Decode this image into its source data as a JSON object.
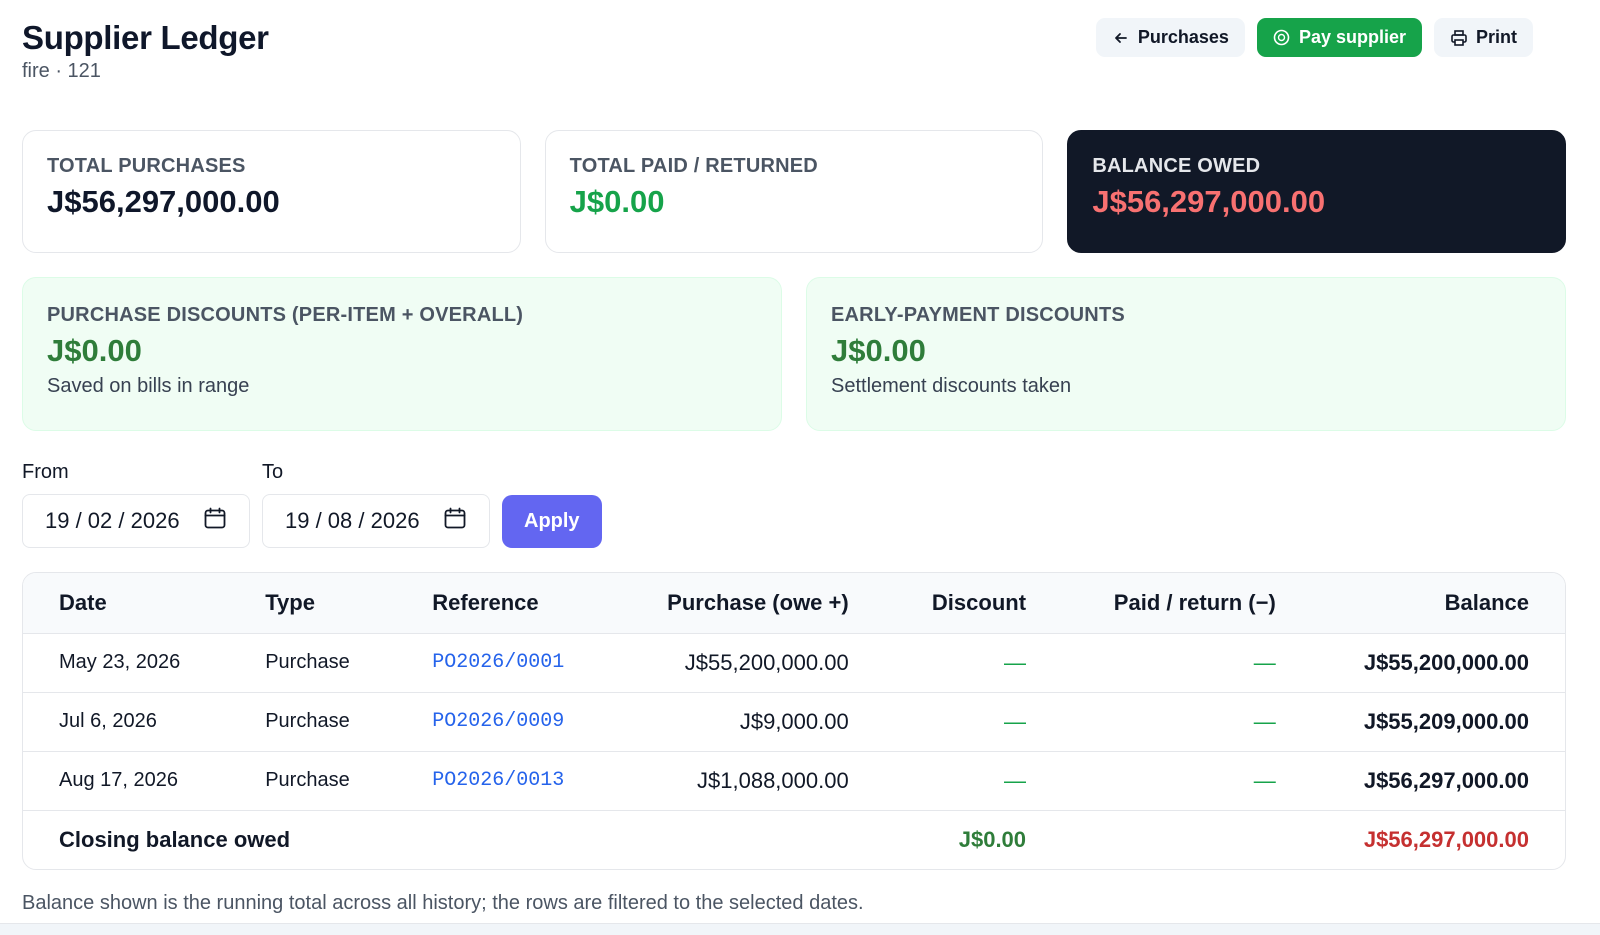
{
  "header": {
    "title": "Supplier Ledger",
    "subtitle": "fire · 121",
    "buttons": {
      "purchases": "Purchases",
      "pay_supplier": "Pay supplier",
      "print": "Print"
    }
  },
  "summary": {
    "total_purchases": {
      "label": "TOTAL PURCHASES",
      "value": "J$56,297,000.00"
    },
    "total_paid": {
      "label": "TOTAL PAID / RETURNED",
      "value": "J$0.00"
    },
    "balance_owed": {
      "label": "BALANCE OWED",
      "value": "J$56,297,000.00"
    }
  },
  "discounts": {
    "purchase": {
      "label": "PURCHASE DISCOUNTS (PER-ITEM + OVERALL)",
      "value": "J$0.00",
      "note": "Saved on bills in range"
    },
    "early_payment": {
      "label": "EARLY-PAYMENT DISCOUNTS",
      "value": "J$0.00",
      "note": "Settlement discounts taken"
    }
  },
  "filters": {
    "from_label": "From",
    "from_value": "19 / 02 / 2026",
    "to_label": "To",
    "to_value": "19 / 08 / 2026",
    "apply_label": "Apply"
  },
  "table": {
    "headers": {
      "date": "Date",
      "type": "Type",
      "reference": "Reference",
      "purchase": "Purchase (owe +)",
      "discount": "Discount",
      "paid": "Paid / return (−)",
      "balance": "Balance"
    },
    "rows": [
      {
        "date": "May 23, 2026",
        "type": "Purchase",
        "reference": "PO2026/0001",
        "purchase": "J$55,200,000.00",
        "discount": "—",
        "paid": "—",
        "balance": "J$55,200,000.00"
      },
      {
        "date": "Jul 6, 2026",
        "type": "Purchase",
        "reference": "PO2026/0009",
        "purchase": "J$9,000.00",
        "discount": "—",
        "paid": "—",
        "balance": "J$55,209,000.00"
      },
      {
        "date": "Aug 17, 2026",
        "type": "Purchase",
        "reference": "PO2026/0013",
        "purchase": "J$1,088,000.00",
        "discount": "—",
        "paid": "—",
        "balance": "J$56,297,000.00"
      }
    ],
    "closing": {
      "label": "Closing balance owed",
      "discount": "J$0.00",
      "balance": "J$56,297,000.00"
    }
  },
  "note": "Balance shown is the running total across all history; the rows are filtered to the selected dates.",
  "icons": {
    "back": "arrow-left-icon",
    "pay": "coin-icon",
    "print": "printer-icon",
    "calendar": "calendar-icon"
  },
  "colors": {
    "accent_green": "#16a34a",
    "accent_indigo": "#6366f1",
    "balance_red": "#c53030",
    "dark_card": "#111827",
    "link_blue": "#2563eb"
  }
}
